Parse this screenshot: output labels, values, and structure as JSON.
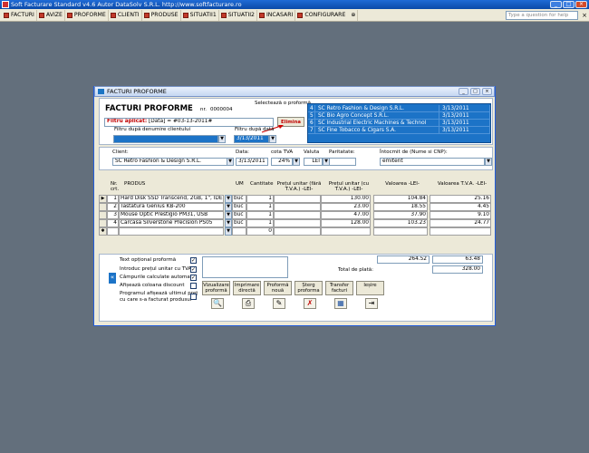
{
  "app": {
    "title": "Soft Facturare Standard v4.6 Autor DataSolv S.R.L. http://www.softfacturare.ro",
    "help_placeholder": "Type a question for help"
  },
  "menu": [
    {
      "label": "FACTURI"
    },
    {
      "label": "AVIZE"
    },
    {
      "label": "PROFORME"
    },
    {
      "label": "CLIENTI"
    },
    {
      "label": "PRODUSE"
    },
    {
      "label": "SITUATII1"
    },
    {
      "label": "SITUATII2"
    },
    {
      "label": "INCASARI"
    },
    {
      "label": "CONFIGURARE"
    }
  ],
  "window": {
    "title": "FACTURI PROFORME"
  },
  "form": {
    "heading": "FACTURI PROFORME",
    "nr_label": "nr.",
    "nr": "0000004",
    "filter_label": "Filtru aplicat:",
    "filter_value": "[Data] = #03-13-2011#",
    "elimina": "Elimina",
    "client_filter_label": "Filtru după denumire clientului",
    "client_filter_value": "",
    "date_filter_label": "Filtru după dată",
    "date_filter_value": "3/13/2011",
    "select_label": "Selectează o proformă",
    "proforms": [
      {
        "nr": "4",
        "client": "SC Retro Fashion & Design S.R.L.",
        "date": "3/13/2011"
      },
      {
        "nr": "5",
        "client": "SC Bio Agro Concept S.R.L.",
        "date": "3/13/2011"
      },
      {
        "nr": "6",
        "client": "SC Industrial Electric Machines & Technol",
        "date": "3/13/2011"
      },
      {
        "nr": "7",
        "client": "SC Fine Tobacco & Cigars S.A.",
        "date": "3/13/2011"
      }
    ],
    "client_label": "Client:",
    "client_value": "SC Retro Fashion & Design S.R.L.",
    "data_label": "Data:",
    "data_value": "3/13/2011",
    "tva_label": "cota TVA",
    "tva_value": "24%",
    "valuta_label": "Valuta",
    "valuta_value": "LEI",
    "paritate_label": "Paritatate:",
    "paritate_value": "",
    "intocmit_label": "Întocmit de (Nume si CNP):",
    "intocmit_value": "emitent"
  },
  "table": {
    "headers": {
      "nr": "Nr. crt.",
      "produs": "PRODUS",
      "um": "UM",
      "cantitate": "Cantitate",
      "pret_fara": "Prețul unitar (fără T.V.A.) -LEI-",
      "pret_cu": "Prețul unitar (cu T.V.A.) -LEI-",
      "valoarea": "Valoarea -LEI-",
      "valoarea_tva": "Valoarea T.V.A. -LEI-"
    },
    "rows": [
      {
        "nr": "1",
        "produs": "Hard Disk SSD Transcend, 2GB, 1\", IDE,",
        "um": "buc",
        "cantitate": "1",
        "pret_fara": "",
        "pret_cu": "130.00",
        "valoarea": "104.84",
        "valoarea_tva": "25.16"
      },
      {
        "nr": "2",
        "produs": "Tastatura Genius KB-200",
        "um": "buc",
        "cantitate": "1",
        "pret_fara": "",
        "pret_cu": "23.00",
        "valoarea": "18.55",
        "valoarea_tva": "4.45"
      },
      {
        "nr": "3",
        "produs": "Mouse Optic Prestigio PM31, USB",
        "um": "buc",
        "cantitate": "1",
        "pret_fara": "",
        "pret_cu": "47.00",
        "valoarea": "37.90",
        "valoarea_tva": "9.10"
      },
      {
        "nr": "4",
        "produs": "Carcasa Silverstone Precision PS05",
        "um": "buc",
        "cantitate": "1",
        "pret_fara": "",
        "pret_cu": "128.00",
        "valoarea": "103.23",
        "valoarea_tva": "24.77"
      },
      {
        "nr": "",
        "produs": "",
        "um": "",
        "cantitate": "0",
        "pret_fara": "",
        "pret_cu": "",
        "valoarea": "",
        "valoarea_tva": ""
      }
    ]
  },
  "options": {
    "text_optional": "Text opțional proformă",
    "introduc_pret": "Introduc prețul unitar cu TVA",
    "campurile": "Câmpurile calculate automat",
    "afiseaza": "Afișează coloana discount",
    "programul_1": "Programul afișează ultimul preț",
    "programul_2": "cu care s-a facturat produsul"
  },
  "totals": {
    "valoare": "264.52",
    "tva": "63.48",
    "total_label": "Total de plată:",
    "total": "328.00"
  },
  "actions": {
    "vizualizare": "Vizualizare proformă",
    "imprimare": "Imprimare directă",
    "noua": "Proformă nouă",
    "sterg": "Șterg proforma",
    "transfer": "Transfer facturi",
    "iesire": "Ieșire"
  }
}
